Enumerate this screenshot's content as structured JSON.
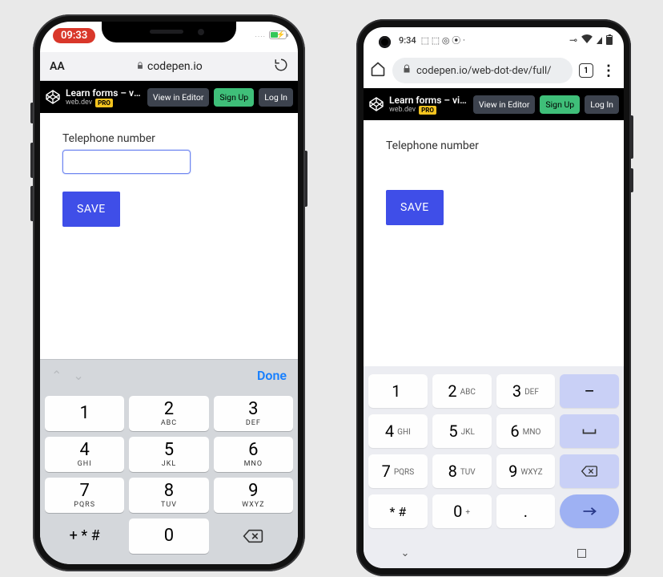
{
  "iphone": {
    "status": {
      "time": "09:33",
      "battery_dots": "....",
      "bolt": "⚡"
    },
    "browser": {
      "aA": "AA",
      "lock": "🔒",
      "url": "codepen.io"
    },
    "codepen": {
      "title": "Learn forms – virt…",
      "subtitle": "web.dev",
      "pro": "PRO",
      "buttons": {
        "view": "View in Editor",
        "signup": "Sign Up",
        "login": "Log In"
      }
    },
    "page": {
      "label": "Telephone number",
      "save": "SAVE"
    },
    "accessory": {
      "up": "⌃",
      "down": "⌄",
      "done": "Done"
    },
    "keypad": {
      "rows": [
        [
          {
            "n": "1",
            "s": ""
          },
          {
            "n": "2",
            "s": "ABC"
          },
          {
            "n": "3",
            "s": "DEF"
          }
        ],
        [
          {
            "n": "4",
            "s": "GHI"
          },
          {
            "n": "5",
            "s": "JKL"
          },
          {
            "n": "6",
            "s": "MNO"
          }
        ],
        [
          {
            "n": "7",
            "s": "PQRS"
          },
          {
            "n": "8",
            "s": "TUV"
          },
          {
            "n": "9",
            "s": "WXYZ"
          }
        ]
      ],
      "bottom": {
        "sym": "+ * #",
        "zero": "0",
        "bksp": "⌫"
      }
    }
  },
  "android": {
    "status": {
      "time": "9:34",
      "licons": "⬚ ⬚ ◎ ⦿ ·",
      "key": "⊸",
      "wifi": "▾"
    },
    "browser": {
      "home": "⌂",
      "lock": "🔒",
      "url": "codepen.io/web-dot-dev/full/",
      "tabs": "1",
      "menu": "⋮"
    },
    "codepen": {
      "title": "Learn forms – virt…",
      "subtitle": "web.dev",
      "pro": "PRO",
      "buttons": {
        "view": "View in Editor",
        "signup": "Sign Up",
        "login": "Log In"
      }
    },
    "page": {
      "label": "Telephone number",
      "input_value": "|",
      "save": "SAVE"
    },
    "keypad": {
      "rows": [
        [
          {
            "n": "1",
            "s": ""
          },
          {
            "n": "2",
            "s": "ABC"
          },
          {
            "n": "3",
            "s": "DEF"
          },
          {
            "n": "–",
            "s": "",
            "alt": true
          }
        ],
        [
          {
            "n": "4",
            "s": "GHI"
          },
          {
            "n": "5",
            "s": "JKL"
          },
          {
            "n": "6",
            "s": "MNO"
          },
          {
            "n": "␣",
            "s": "",
            "alt": true,
            "space": true
          }
        ],
        [
          {
            "n": "7",
            "s": "PQRS"
          },
          {
            "n": "8",
            "s": "TUV"
          },
          {
            "n": "9",
            "s": "WXYZ"
          },
          {
            "n": "⌫",
            "s": "",
            "alt": true,
            "bksp": true
          }
        ],
        [
          {
            "n": "* #",
            "s": ""
          },
          {
            "n": "0",
            "s": "+"
          },
          {
            "n": ".",
            "s": ""
          },
          {
            "n": "→",
            "s": "",
            "enter": true
          }
        ]
      ],
      "nav": {
        "down": "⌄",
        "pill": "",
        "square": "□"
      }
    }
  }
}
